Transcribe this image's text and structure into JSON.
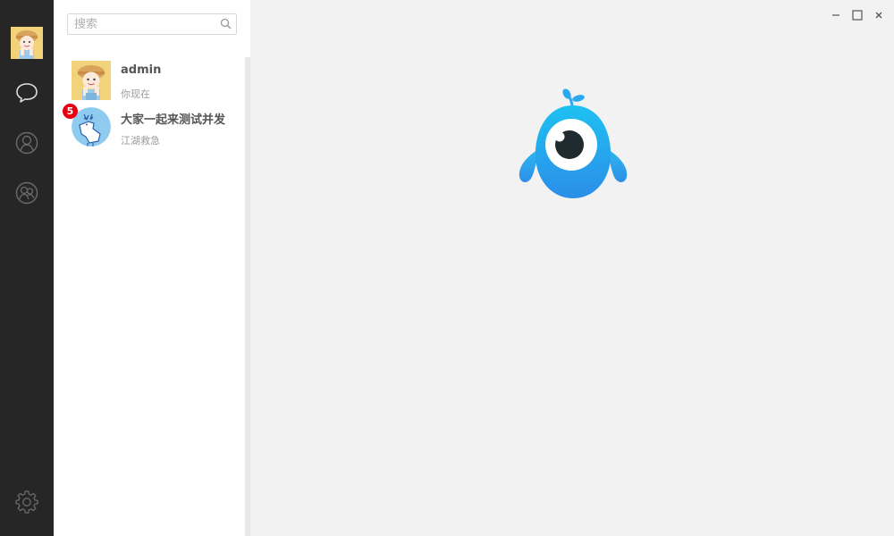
{
  "sidebar": {
    "icons": [
      "chat-icon",
      "contacts-icon",
      "groups-icon",
      "settings-icon"
    ]
  },
  "search": {
    "placeholder": "搜索",
    "value": ""
  },
  "conversations": [
    {
      "name": "admin",
      "last_message": "你现在",
      "unread": ""
    },
    {
      "name": "大家一起来测试并发",
      "last_message": "江湖救急",
      "unread": "5"
    }
  ],
  "window_controls": [
    "minimize-icon",
    "maximize-icon",
    "close-icon"
  ],
  "colors": {
    "nav_bg": "#262626",
    "badge": "#e60012",
    "mascot_blue": "#2aa9f0"
  }
}
